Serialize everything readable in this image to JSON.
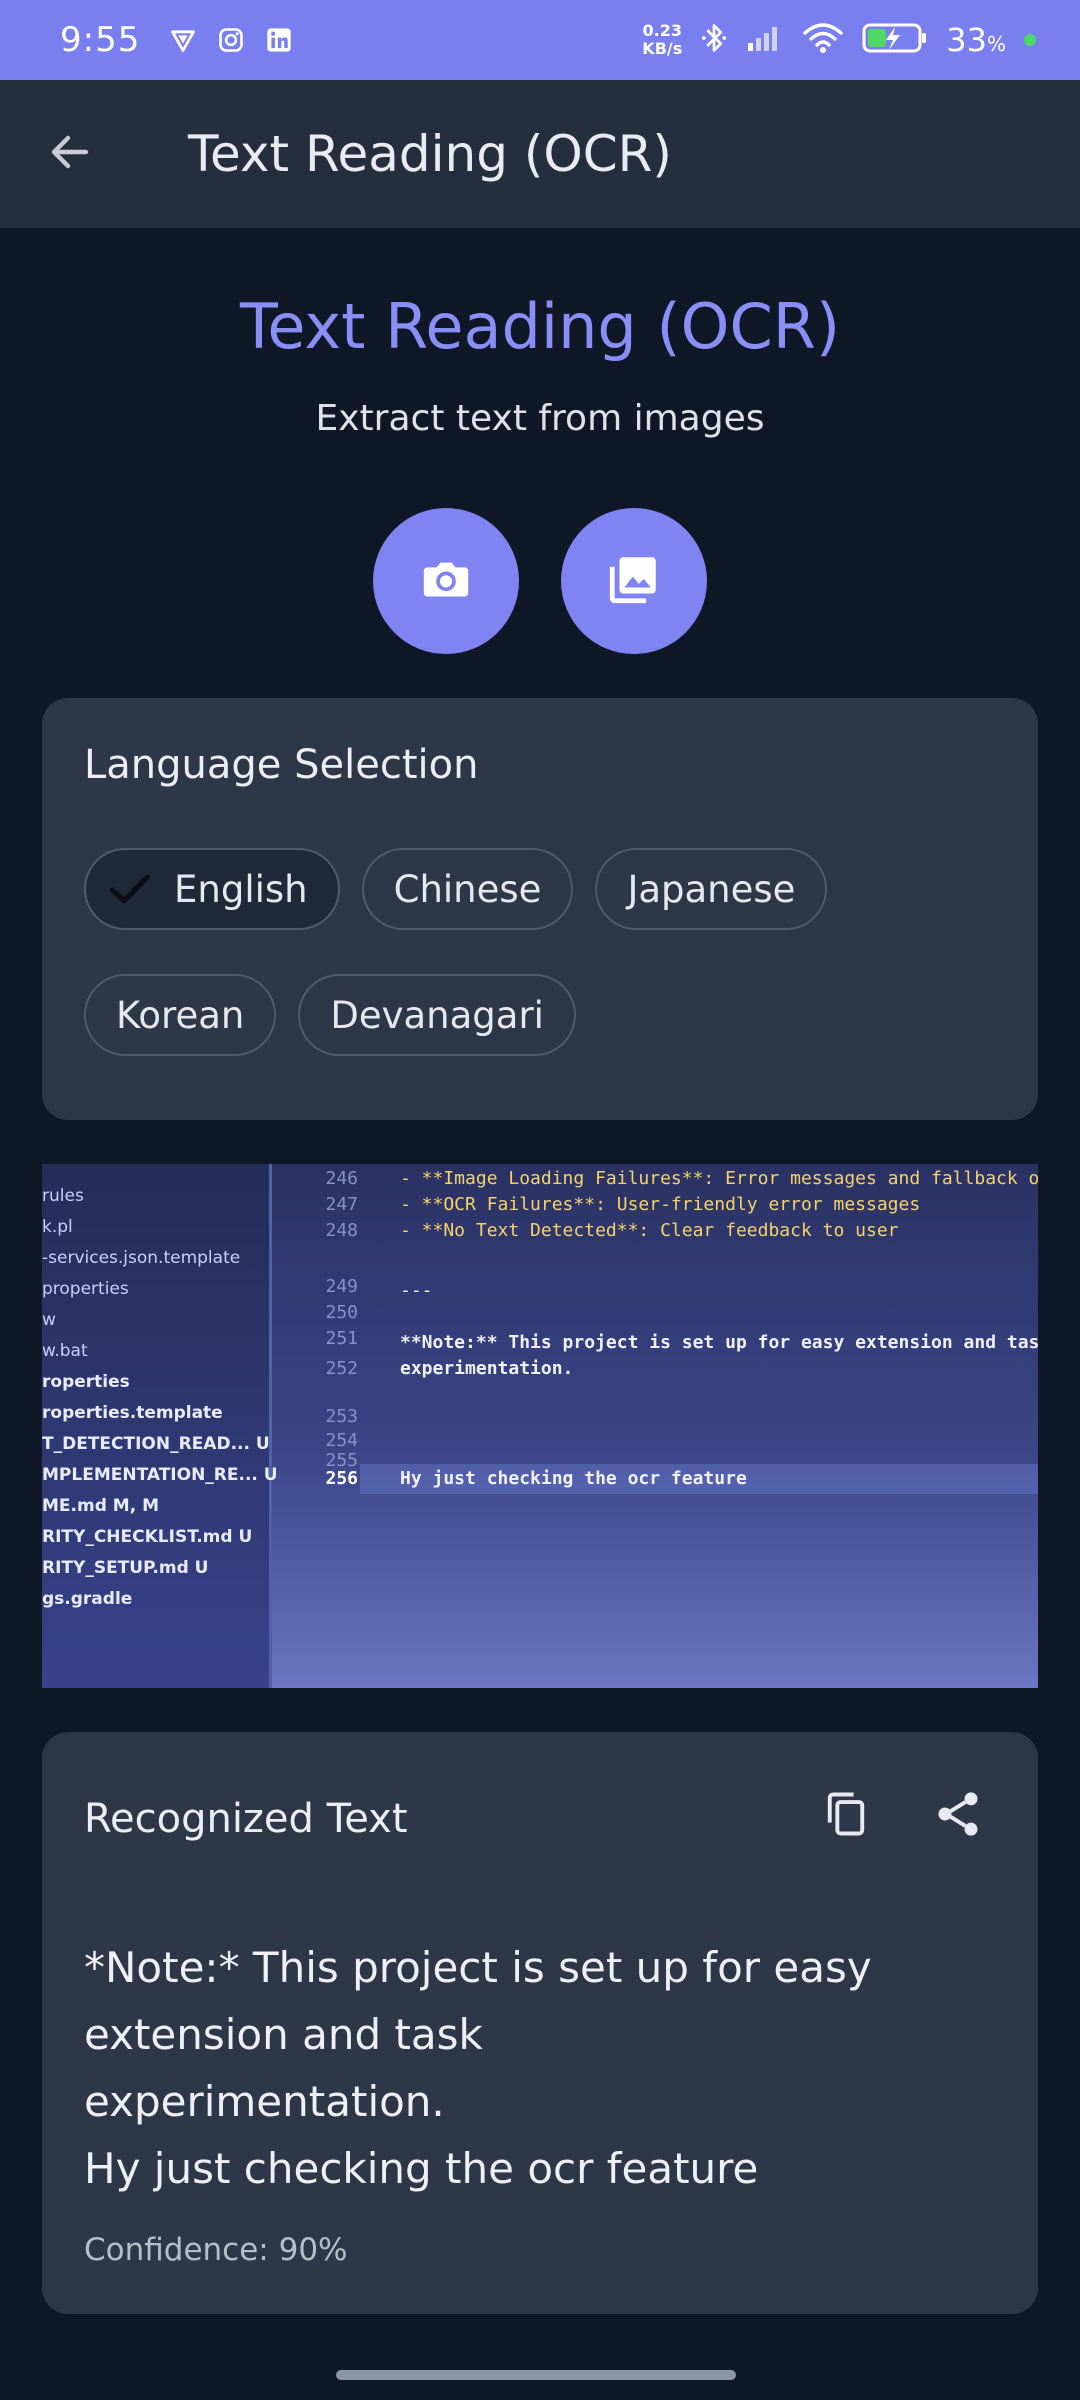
{
  "status_bar": {
    "time": "9:55",
    "net_speed_value": "0.23",
    "net_speed_unit": "KB/s",
    "battery_percent": "33",
    "battery_unit": "%",
    "left_icons": [
      "vpn-shield-icon",
      "instagram-icon",
      "linkedin-icon"
    ],
    "right_icons": [
      "bluetooth-icon",
      "signal-icon",
      "wifi-icon",
      "battery-charging-icon"
    ]
  },
  "app_bar": {
    "title": "Text Reading (OCR)",
    "back_icon": "arrow-left-icon"
  },
  "hero": {
    "title": "Text Reading (OCR)",
    "subtitle": "Extract text from images"
  },
  "actions": {
    "camera_icon": "camera-icon",
    "gallery_icon": "gallery-icon"
  },
  "language": {
    "title": "Language Selection",
    "options": [
      "English",
      "Chinese",
      "Japanese",
      "Korean",
      "Devanagari"
    ],
    "selected": "English"
  },
  "preview": {
    "left_panel": [
      "rules",
      "k.pl",
      "-services.json.template",
      "properties",
      "w",
      "w.bat",
      "roperties",
      "roperties.template",
      "T_DETECTION_READ...  U",
      "MPLEMENTATION_RE...  U",
      "ME.md          M, M",
      "RITY_CHECKLIST.md   U",
      "RITY_SETUP.md       U",
      "gs.gradle"
    ],
    "line_numbers": [
      "246",
      "247",
      "248",
      "249",
      "250",
      "251",
      "252",
      "253",
      "254",
      "255",
      "256"
    ],
    "code_lines": [
      "- **Image Loading Failures**: Error messages and fallback optic",
      "- **OCR Failures**: User-friendly error messages",
      "- **No Text Detected**: Clear feedback to user",
      "---",
      "**Note:** This project is set up for easy extension and task",
      "experimentation.",
      "Hy just checking the ocr feature"
    ]
  },
  "result": {
    "title": "Recognized Text",
    "copy_icon": "copy-icon",
    "share_icon": "share-icon",
    "text": "*Note:* This project is set up for easy\nextension and task\nexperimentation.\nHy just checking the ocr feature",
    "confidence": "Confidence: 90%"
  },
  "colors": {
    "accent": "#7f84f2",
    "status_bar": "#7a7ff0",
    "background": "#101827",
    "card": "#2d3747",
    "app_bar": "#252e3c"
  }
}
